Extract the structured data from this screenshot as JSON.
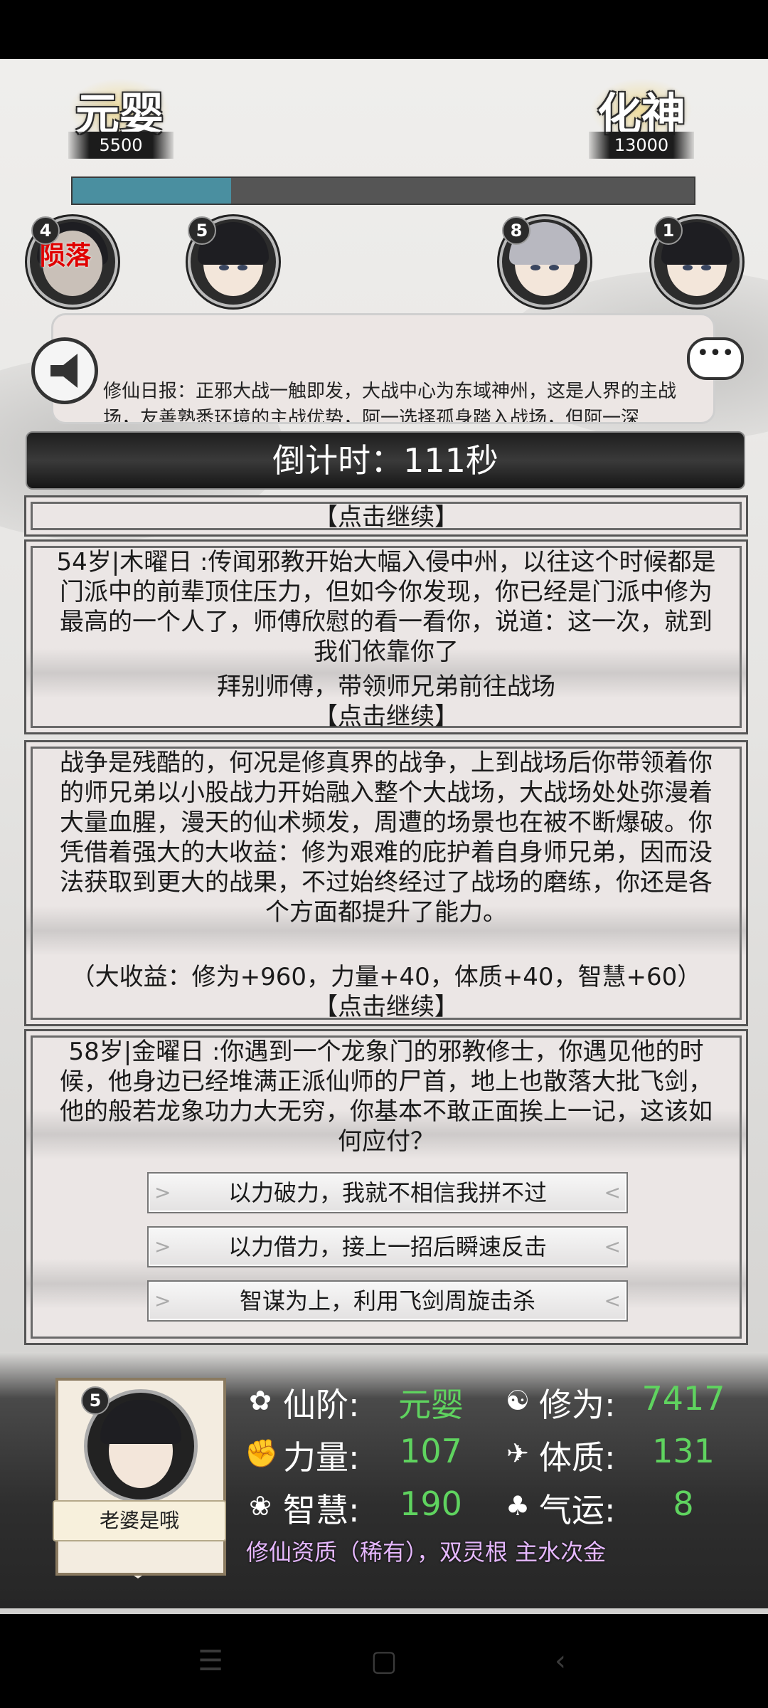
{
  "header": {
    "current_realm": "元婴",
    "current_realm_value": "5500",
    "next_realm": "化神",
    "next_realm_value": "13000",
    "progress_fraction": 0.255,
    "progress_color": "#4a8fa0"
  },
  "rivals": [
    {
      "rank": "4",
      "status": "陨落"
    },
    {
      "rank": "5"
    },
    {
      "rank": "8"
    },
    {
      "rank": "1"
    }
  ],
  "news": {
    "text": "修仙日报：正邪大战一触即发，大战中心为东域神州，这是人界的主战场，友善熟悉环境的主战优势，阿一选择孤身踏入战场，但阿一深"
  },
  "countdown": "倒计时：111秒",
  "events": {
    "continue_label": "【点击继续】",
    "e1_text": "54岁|木曜日 :传闻邪教开始大幅入侵中州，以往这个时候都是门派中的前辈顶住压力，但如今你发现，你已经是门派中修为最高的一个人了，师傅欣慰的看一看你，说道：这一次，就到我们依靠你了",
    "e1_choice": "拜别师傅，带领师兄弟前往战场",
    "e2_text": "战争是残酷的，何况是修真界的战争，上到战场后你带领着你的师兄弟以小股战力开始融入整个大战场，大战场处处弥漫着大量血腥，漫天的仙术频发，周遭的场景也在被不断爆破。你凭借着强大的大收益：修为艰难的庇护着自身师兄弟，因而没法获取到更大的战果，不过始终经过了战场的磨练，你还是各个方面都提升了能力。",
    "e2_reward": "（大收益：修为+960，力量+40，体质+40，智慧+60）",
    "e3_text": "58岁|金曜日 :你遇到一个龙象门的邪教修士，你遇见他的时候，他身边已经堆满正派仙师的尸首，地上也散落大批飞剑，他的般若龙象功力大无穷，你基本不敢正面挨上一记，这该如何应付？",
    "options": [
      "以力破力，我就不相信我拼不过",
      "以力借力，接上一招后瞬速反击",
      "智谋为上，利用飞剑周旋击杀"
    ]
  },
  "player": {
    "rank": "5",
    "name": "老婆是哦",
    "stats": {
      "realm_label": "仙阶:",
      "realm_value": "元婴",
      "cultivation_label": "修为:",
      "cultivation_value": "7417",
      "strength_label": "力量:",
      "strength_value": "107",
      "constitution_label": "体质:",
      "constitution_value": "131",
      "wisdom_label": "智慧:",
      "wisdom_value": "190",
      "luck_label": "气运:",
      "luck_value": "8"
    },
    "aptitude": "修仙资质（稀有），双灵根 主水次金"
  },
  "colors": {
    "stat_value": "#5fd35f",
    "highlight": "#f39a1a",
    "aptitude": "#e6b8ff",
    "fallen": "#e00000"
  },
  "nav": {
    "icons": [
      "menu-icon",
      "home-icon",
      "back-icon"
    ]
  }
}
